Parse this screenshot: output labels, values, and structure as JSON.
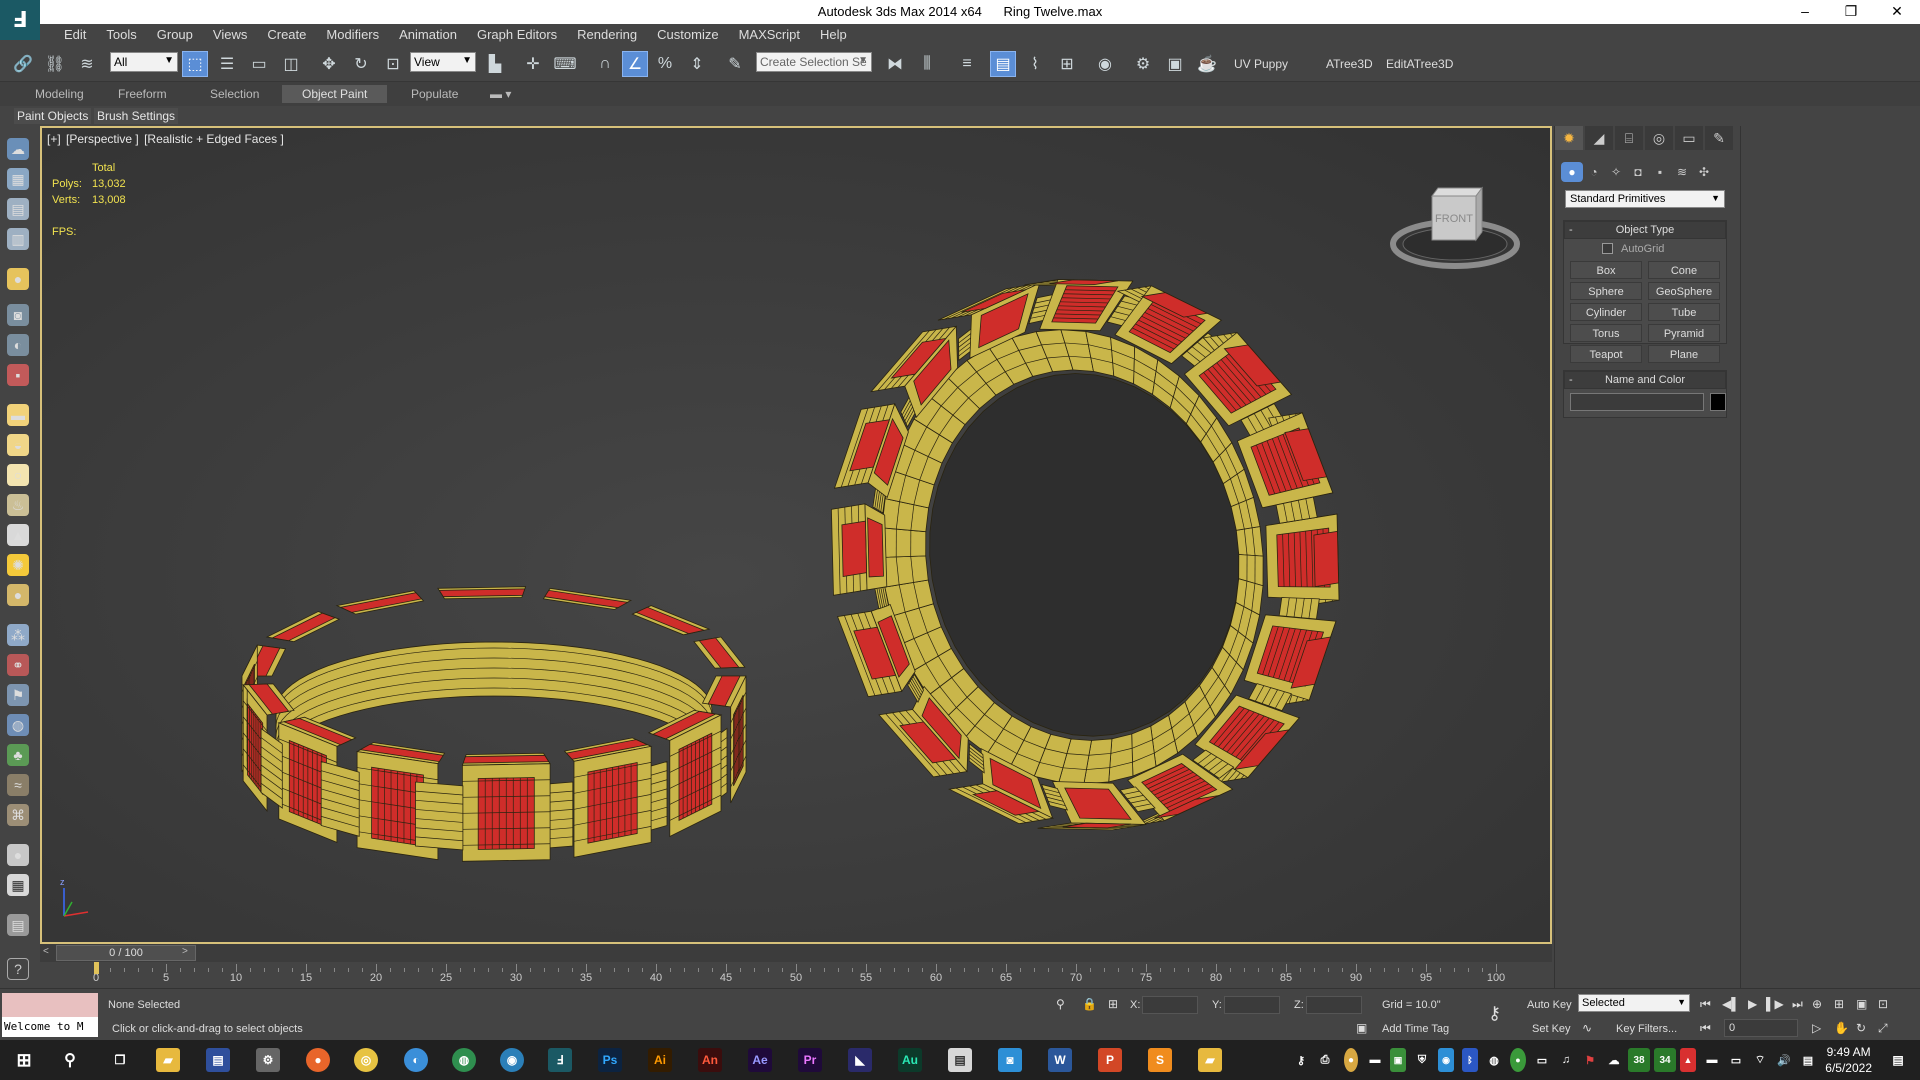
{
  "window": {
    "app_title": "Autodesk 3ds Max  2014 x64",
    "file_name": "Ring Twelve.max",
    "minimize": "–",
    "restore": "❐",
    "close": "✕"
  },
  "menu": [
    "Edit",
    "Tools",
    "Group",
    "Views",
    "Create",
    "Modifiers",
    "Animation",
    "Graph Editors",
    "Rendering",
    "Customize",
    "MAXScript",
    "Help"
  ],
  "toolbar": {
    "selection_filter": "All",
    "ref_coord": "View",
    "named_selection_placeholder": "Create Selection Se",
    "plugin_uv_puppy": "UV Puppy",
    "plugin_atree": "ATree3D",
    "plugin_edit_atree": "EditATree3D"
  },
  "ribbon": {
    "tabs": [
      "Modeling",
      "Freeform",
      "Selection",
      "Object Paint",
      "Populate"
    ],
    "active_tab": "Object Paint",
    "sub_items": [
      "Paint Objects",
      "Brush Settings"
    ]
  },
  "viewport": {
    "label_parts": [
      "[+]",
      "[Perspective ]",
      "[Realistic + Edged Faces ]"
    ],
    "stats": {
      "total_label": "Total",
      "polys_label": "Polys:",
      "polys_value": "13,032",
      "verts_label": "Verts:",
      "verts_value": "13,008",
      "fps_label": "FPS:"
    },
    "viewcube_face": "FRONT",
    "colors": {
      "gold": "#c9b64a",
      "red": "#cf2d2a",
      "edge": "#2a2410"
    }
  },
  "command_panel": {
    "category": "Standard Primitives",
    "object_type_title": "Object Type",
    "autogrid_label": "AutoGrid",
    "buttons": [
      "Box",
      "Cone",
      "Sphere",
      "GeoSphere",
      "Cylinder",
      "Tube",
      "Torus",
      "Pyramid",
      "Teapot",
      "Plane"
    ],
    "name_color_title": "Name and Color",
    "collapse_glyph": "-"
  },
  "timeline": {
    "slider_text": "0 / 100",
    "ticks": [
      "0",
      "5",
      "10",
      "15",
      "20",
      "25",
      "30",
      "35",
      "40",
      "45",
      "50",
      "55",
      "60",
      "65",
      "70",
      "75",
      "80",
      "85",
      "90",
      "95",
      "100"
    ]
  },
  "status": {
    "listener_text": "Welcome to M",
    "selection": "None Selected",
    "prompt": "Click or click-and-drag to select objects",
    "x_label": "X:",
    "y_label": "Y:",
    "z_label": "Z:",
    "grid": "Grid = 10.0\"",
    "add_time_tag": "Add Time Tag",
    "auto_key": "Auto Key",
    "set_key": "Set Key",
    "key_mode": "Selected",
    "key_filters": "Key Filters...",
    "current_frame": "0"
  },
  "taskbar": {
    "apps": [
      "Ps",
      "Ai",
      "An",
      "Ae",
      "Pr",
      "Au",
      "W",
      "P"
    ],
    "clock_time": "9:49 AM",
    "clock_date": "6/5/2022",
    "tray_badges": [
      "38",
      "34"
    ]
  }
}
